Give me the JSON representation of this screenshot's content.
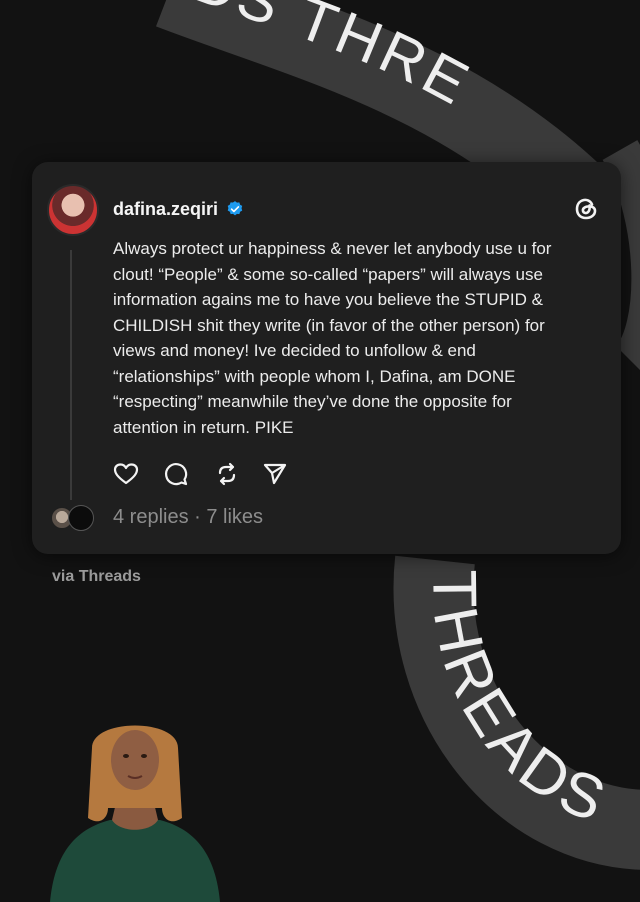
{
  "background": {
    "ribbon_text_top": "DS THRE",
    "ribbon_text_right": "THREADS",
    "colors": {
      "page": "#121212",
      "ribbon": "#3a3a3a",
      "ribbon_text": "#eeeeee"
    }
  },
  "post": {
    "username": "dafina.zeqiri",
    "verified": true,
    "text": "Always protect ur happiness & never let anybody use u for\nclout! “People” & some so-called “papers” will always use\ninformation agains me to have you believe the STUPID &\nCHILDISH shit they write (in favor of the other person) for\nviews and money! Ive decided to unfollow & end\n“relationships” with people whom I, Dafina, am DONE\n“respecting” meanwhile they’ve done the opposite for\nattention in return. PIKE",
    "actions": [
      "heart-icon",
      "comment-icon",
      "repost-icon",
      "share-icon"
    ],
    "stats": "4 replies · 7 likes"
  },
  "caption": "via Threads",
  "colors": {
    "card": "#1f1f1f",
    "verified_blue": "#1d9bf0",
    "muted": "#8d8d8d"
  }
}
